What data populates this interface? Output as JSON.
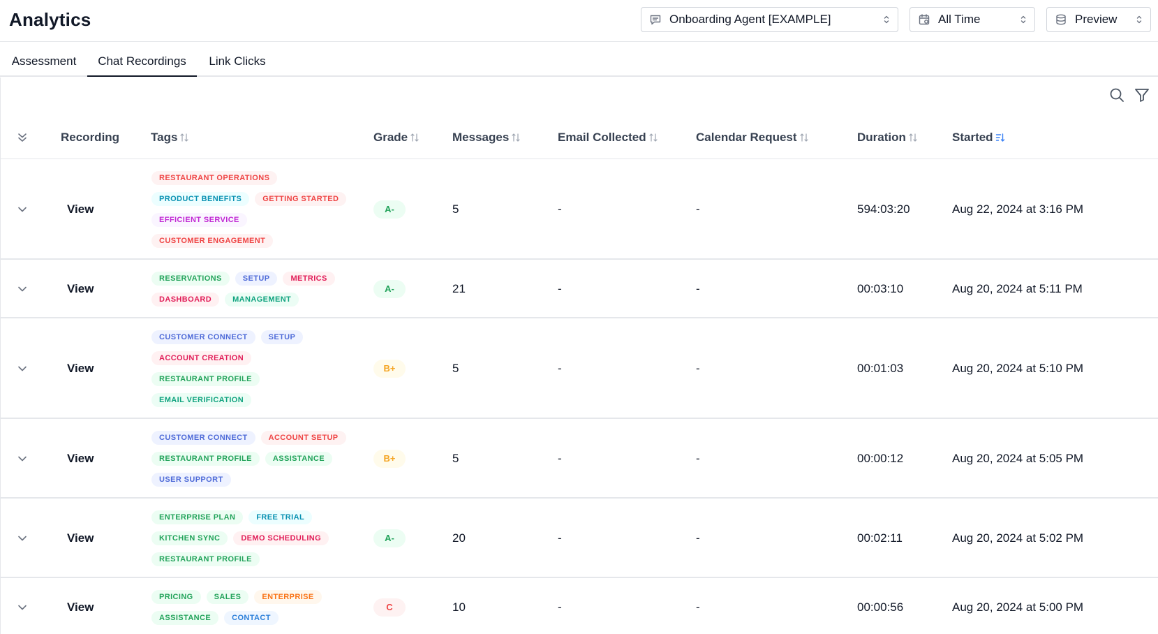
{
  "header": {
    "title": "Analytics",
    "agent_select": {
      "value": "Onboarding Agent [EXAMPLE]",
      "icon": "chat-bubble-icon"
    },
    "time_select": {
      "value": "All Time",
      "icon": "calendar-icon"
    },
    "env_select": {
      "value": "Preview",
      "icon": "database-icon"
    }
  },
  "tabs": [
    {
      "label": "Assessment",
      "active": false
    },
    {
      "label": "Chat Recordings",
      "active": true
    },
    {
      "label": "Link Clicks",
      "active": false
    }
  ],
  "toolbar": {
    "search_icon": "search-icon",
    "filter_icon": "filter-icon"
  },
  "table": {
    "columns": [
      "Recording",
      "Tags",
      "Grade",
      "Messages",
      "Email Collected",
      "Calendar Request",
      "Duration",
      "Started"
    ],
    "sorted_column": "Started",
    "rows": [
      {
        "view_label": "View",
        "tags": [
          {
            "label": "RESTAURANT OPERATIONS",
            "color": "red"
          },
          {
            "label": "PRODUCT BENEFITS",
            "color": "cyan"
          },
          {
            "label": "GETTING STARTED",
            "color": "red"
          },
          {
            "label": "EFFICIENT SERVICE",
            "color": "purple"
          },
          {
            "label": "CUSTOMER ENGAGEMENT",
            "color": "red"
          }
        ],
        "grade": "A-",
        "grade_color": "green",
        "messages": "5",
        "email": "-",
        "calendar": "-",
        "duration": "594:03:20",
        "started": "Aug 22, 2024 at 3:16 PM"
      },
      {
        "view_label": "View",
        "tags": [
          {
            "label": "RESERVATIONS",
            "color": "green"
          },
          {
            "label": "SETUP",
            "color": "blue"
          },
          {
            "label": "METRICS",
            "color": "rose"
          },
          {
            "label": "DASHBOARD",
            "color": "rose"
          },
          {
            "label": "MANAGEMENT",
            "color": "emerald"
          }
        ],
        "grade": "A-",
        "grade_color": "green",
        "messages": "21",
        "email": "-",
        "calendar": "-",
        "duration": "00:03:10",
        "started": "Aug 20, 2024 at 5:11 PM"
      },
      {
        "view_label": "View",
        "tags": [
          {
            "label": "CUSTOMER CONNECT",
            "color": "blue"
          },
          {
            "label": "SETUP",
            "color": "blue"
          },
          {
            "label": "ACCOUNT CREATION",
            "color": "rose"
          },
          {
            "label": "RESTAURANT PROFILE",
            "color": "green"
          },
          {
            "label": "EMAIL VERIFICATION",
            "color": "emerald"
          }
        ],
        "grade": "B+",
        "grade_color": "amber",
        "messages": "5",
        "email": "-",
        "calendar": "-",
        "duration": "00:01:03",
        "started": "Aug 20, 2024 at 5:10 PM"
      },
      {
        "view_label": "View",
        "tags": [
          {
            "label": "CUSTOMER CONNECT",
            "color": "blue"
          },
          {
            "label": "ACCOUNT SETUP",
            "color": "red"
          },
          {
            "label": "RESTAURANT PROFILE",
            "color": "green"
          },
          {
            "label": "ASSISTANCE",
            "color": "green"
          },
          {
            "label": "USER SUPPORT",
            "color": "blue"
          }
        ],
        "grade": "B+",
        "grade_color": "amber",
        "messages": "5",
        "email": "-",
        "calendar": "-",
        "duration": "00:00:12",
        "started": "Aug 20, 2024 at 5:05 PM"
      },
      {
        "view_label": "View",
        "tags": [
          {
            "label": "ENTERPRISE PLAN",
            "color": "green"
          },
          {
            "label": "FREE TRIAL",
            "color": "cyan"
          },
          {
            "label": "KITCHEN SYNC",
            "color": "green"
          },
          {
            "label": "DEMO SCHEDULING",
            "color": "rose"
          },
          {
            "label": "RESTAURANT PROFILE",
            "color": "green"
          }
        ],
        "grade": "A-",
        "grade_color": "green",
        "messages": "20",
        "email": "-",
        "calendar": "-",
        "duration": "00:02:11",
        "started": "Aug 20, 2024 at 5:02 PM"
      },
      {
        "view_label": "View",
        "tags": [
          {
            "label": "PRICING",
            "color": "green"
          },
          {
            "label": "SALES",
            "color": "green"
          },
          {
            "label": "ENTERPRISE",
            "color": "orange"
          },
          {
            "label": "ASSISTANCE",
            "color": "green"
          },
          {
            "label": "CONTACT",
            "color": "sky"
          }
        ],
        "grade": "C",
        "grade_color": "red",
        "messages": "10",
        "email": "-",
        "calendar": "-",
        "duration": "00:00:56",
        "started": "Aug 20, 2024 at 5:00 PM"
      }
    ]
  },
  "colors": {
    "accent": "#3b82f6",
    "border": "#e5e7eb",
    "text": "#111827"
  }
}
